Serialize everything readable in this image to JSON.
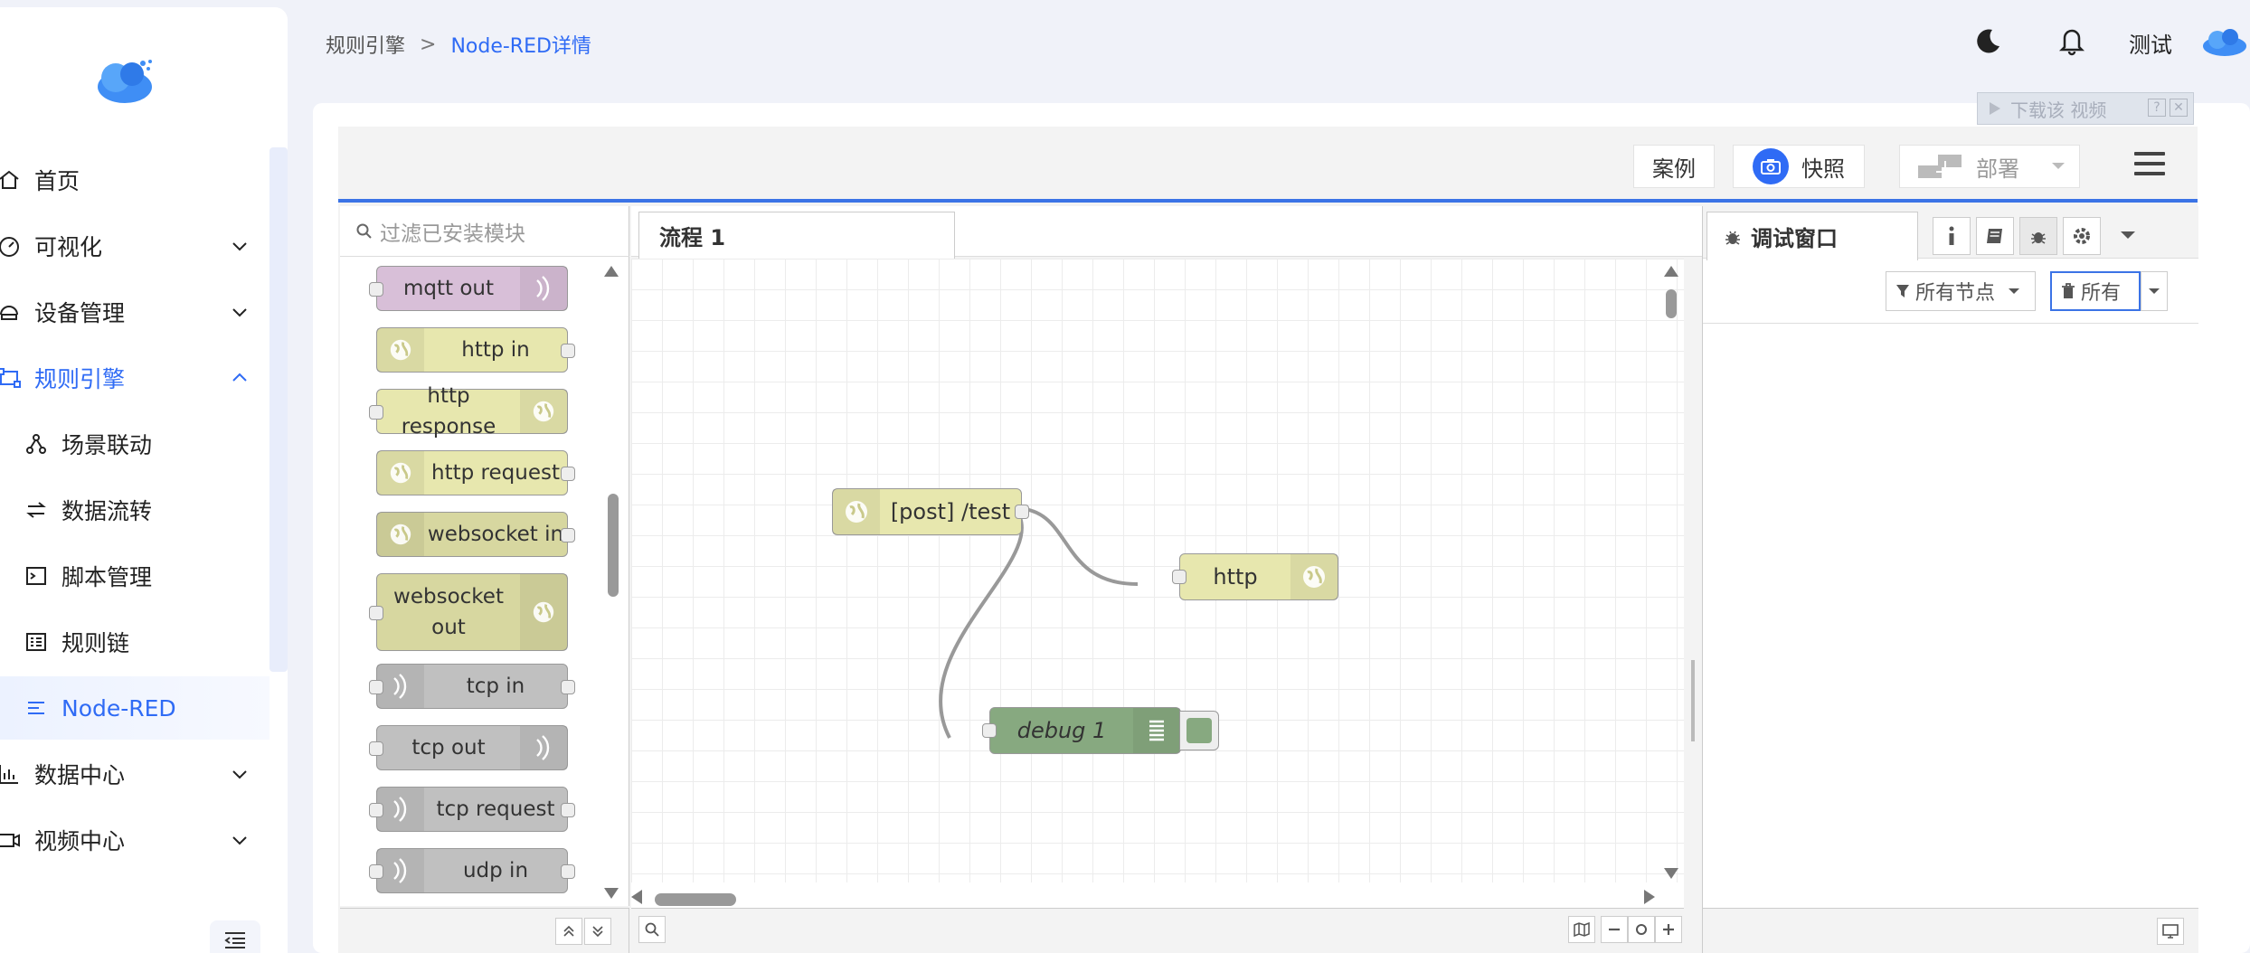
{
  "breadcrumb": {
    "parent": "规则引擎",
    "separator": ">",
    "current": "Node-RED详情"
  },
  "header": {
    "user_name": "测试"
  },
  "sidebar": {
    "items": [
      {
        "label": "首页"
      },
      {
        "label": "可视化"
      },
      {
        "label": "设备管理"
      },
      {
        "label": "规则引擎"
      },
      {
        "label": "场景联动"
      },
      {
        "label": "数据流转"
      },
      {
        "label": "脚本管理"
      },
      {
        "label": "规则链"
      },
      {
        "label": "Node-RED"
      },
      {
        "label": "数据中心"
      },
      {
        "label": "视频中心"
      }
    ]
  },
  "toolbar": {
    "examples": "案例",
    "snapshot": "快照",
    "deploy": "部署"
  },
  "banner": {
    "download_video": "下载该 视频"
  },
  "palette": {
    "search_placeholder": "过滤已安装模块",
    "nodes": [
      {
        "label": "mqtt out",
        "color": "#d8bfd8"
      },
      {
        "label": "http in",
        "color": "#e7e7ae"
      },
      {
        "label": "http response",
        "color": "#e7e7ae"
      },
      {
        "label": "http request",
        "color": "#e7e7ae"
      },
      {
        "label": "websocket in",
        "color": "#d7d7a0"
      },
      {
        "label": "websocket out",
        "color": "#d7d7a0"
      },
      {
        "label": "tcp in",
        "color": "#c0c0c0"
      },
      {
        "label": "tcp out",
        "color": "#c0c0c0"
      },
      {
        "label": "tcp request",
        "color": "#c0c0c0"
      },
      {
        "label": "udp in",
        "color": "#c0c0c0"
      }
    ]
  },
  "workspace": {
    "tab_label": "流程 1",
    "nodes": {
      "post": "[post] /test",
      "http": "http",
      "debug": "debug 1"
    }
  },
  "debug_panel": {
    "tab_label": "调试窗口",
    "filter_nodes": "所有节点",
    "clear_all": "所有"
  },
  "colors": {
    "accent": "#2f6bf5",
    "nr_blue": "#3b73e6",
    "debug_green": "#87a980"
  }
}
